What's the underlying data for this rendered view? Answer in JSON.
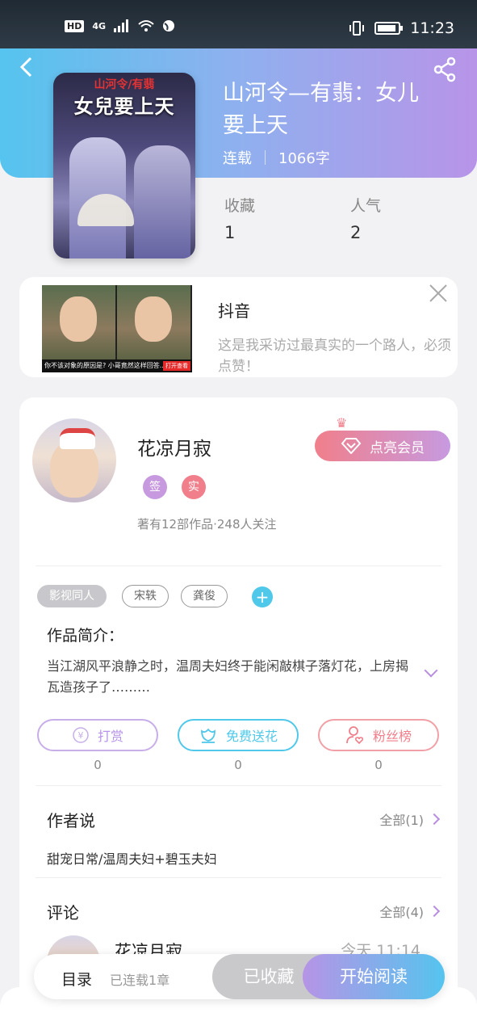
{
  "status_bar": {
    "hd": "HD",
    "network": "4G",
    "time": "11:23"
  },
  "book": {
    "cover_top_text": "山河令/有翡",
    "cover_title": "女兒要上天",
    "title": "山河令—有翡：女儿要上天",
    "status": "连载",
    "word_count": "1066字",
    "favorites_label": "收藏",
    "favorites_value": "1",
    "popularity_label": "人气",
    "popularity_value": "2"
  },
  "ad": {
    "title": "抖音",
    "description": "这是我采访过最真实的一个路人，必须点赞！",
    "caption": "你不该对象的原因是? 小哥竟然这样回答...",
    "open_label": "打开查看"
  },
  "author": {
    "name": "花凉月寂",
    "vip_label": "点亮会员",
    "badge_sign": "签",
    "badge_real": "实",
    "stats": "著有12部作品·248人关注"
  },
  "tags": [
    "影视同人",
    "宋轶",
    "龚俊"
  ],
  "intro": {
    "title": "作品简介：",
    "text": "当江湖风平浪静之时，温周夫妇终于能闲敲棋子落灯花，上房揭瓦造孩子了………"
  },
  "actions": [
    {
      "label": "打赏",
      "count": "0",
      "color": "#b694e6"
    },
    {
      "label": "免费送花",
      "count": "0",
      "color": "#4fc8ea"
    },
    {
      "label": "粉丝榜",
      "count": "0",
      "color": "#f07f8b"
    }
  ],
  "author_say": {
    "title": "作者说",
    "more": "全部(1)",
    "text": "甜宠日常/温周夫妇+碧玉夫妇"
  },
  "comments": {
    "title": "评论",
    "more": "全部(4)",
    "first_name": "花凉月寂",
    "first_time": "今天 11:14"
  },
  "bottom_bar": {
    "toc": "目录",
    "toc_sub": "已连载1章",
    "collected": "已收藏",
    "read": "开始阅读"
  }
}
